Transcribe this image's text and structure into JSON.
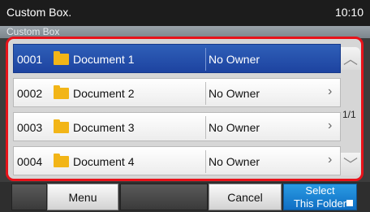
{
  "window": {
    "title": "Custom Box.",
    "subtitle": "Custom Box",
    "clock": "10:10"
  },
  "list": {
    "rows": [
      {
        "number": "0001",
        "name": "Document 1",
        "owner": "No Owner",
        "selected": true
      },
      {
        "number": "0002",
        "name": "Document 2",
        "owner": "No Owner",
        "selected": false
      },
      {
        "number": "0003",
        "name": "Document 3",
        "owner": "No Owner",
        "selected": false
      },
      {
        "number": "0004",
        "name": "Document 4",
        "owner": "No Owner",
        "selected": false
      }
    ],
    "page_indicator": "1/1",
    "scroll_up_icon": "chevron-up-icon",
    "scroll_down_icon": "chevron-down-icon"
  },
  "buttons": {
    "menu": "Menu",
    "cancel": "Cancel",
    "select_folder_line1": "Select",
    "select_folder_line2": "This Folder"
  },
  "colors": {
    "selection": "#1d43a0",
    "highlight_frame": "#e8121a",
    "primary_button": "#0f6ec4",
    "folder": "#f2b517"
  }
}
